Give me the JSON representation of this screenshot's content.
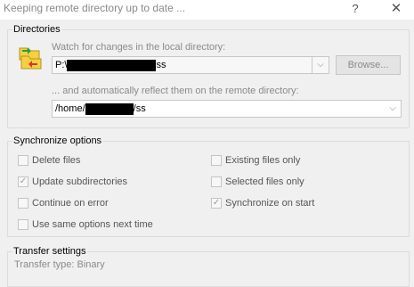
{
  "window": {
    "title": "Keeping remote directory up to date ...",
    "help_glyph": "?",
    "close_glyph": "✕"
  },
  "directories": {
    "group_title": "Directories",
    "local_label": "Watch for changes in the local directory:",
    "local_prefix": "P:\\",
    "local_suffix": "ss",
    "browse_label": "Browse...",
    "remote_label": "... and automatically reflect them on the remote directory:",
    "remote_prefix": "/home/",
    "remote_suffix": "/ss",
    "dropdown_glyph": "⌵"
  },
  "sync_options": {
    "group_title": "Synchronize options",
    "items": [
      {
        "label": "Delete files",
        "checked": false
      },
      {
        "label": "Existing files only",
        "checked": false
      },
      {
        "label": "Update subdirectories",
        "checked": true
      },
      {
        "label": "Selected files only",
        "checked": false
      },
      {
        "label": "Continue on error",
        "checked": false
      },
      {
        "label": "Synchronize on start",
        "checked": true
      },
      {
        "label": "Use same options next time",
        "checked": false
      }
    ]
  },
  "transfer": {
    "group_title": "Transfer settings",
    "type_text": "Transfer type: Binary"
  }
}
